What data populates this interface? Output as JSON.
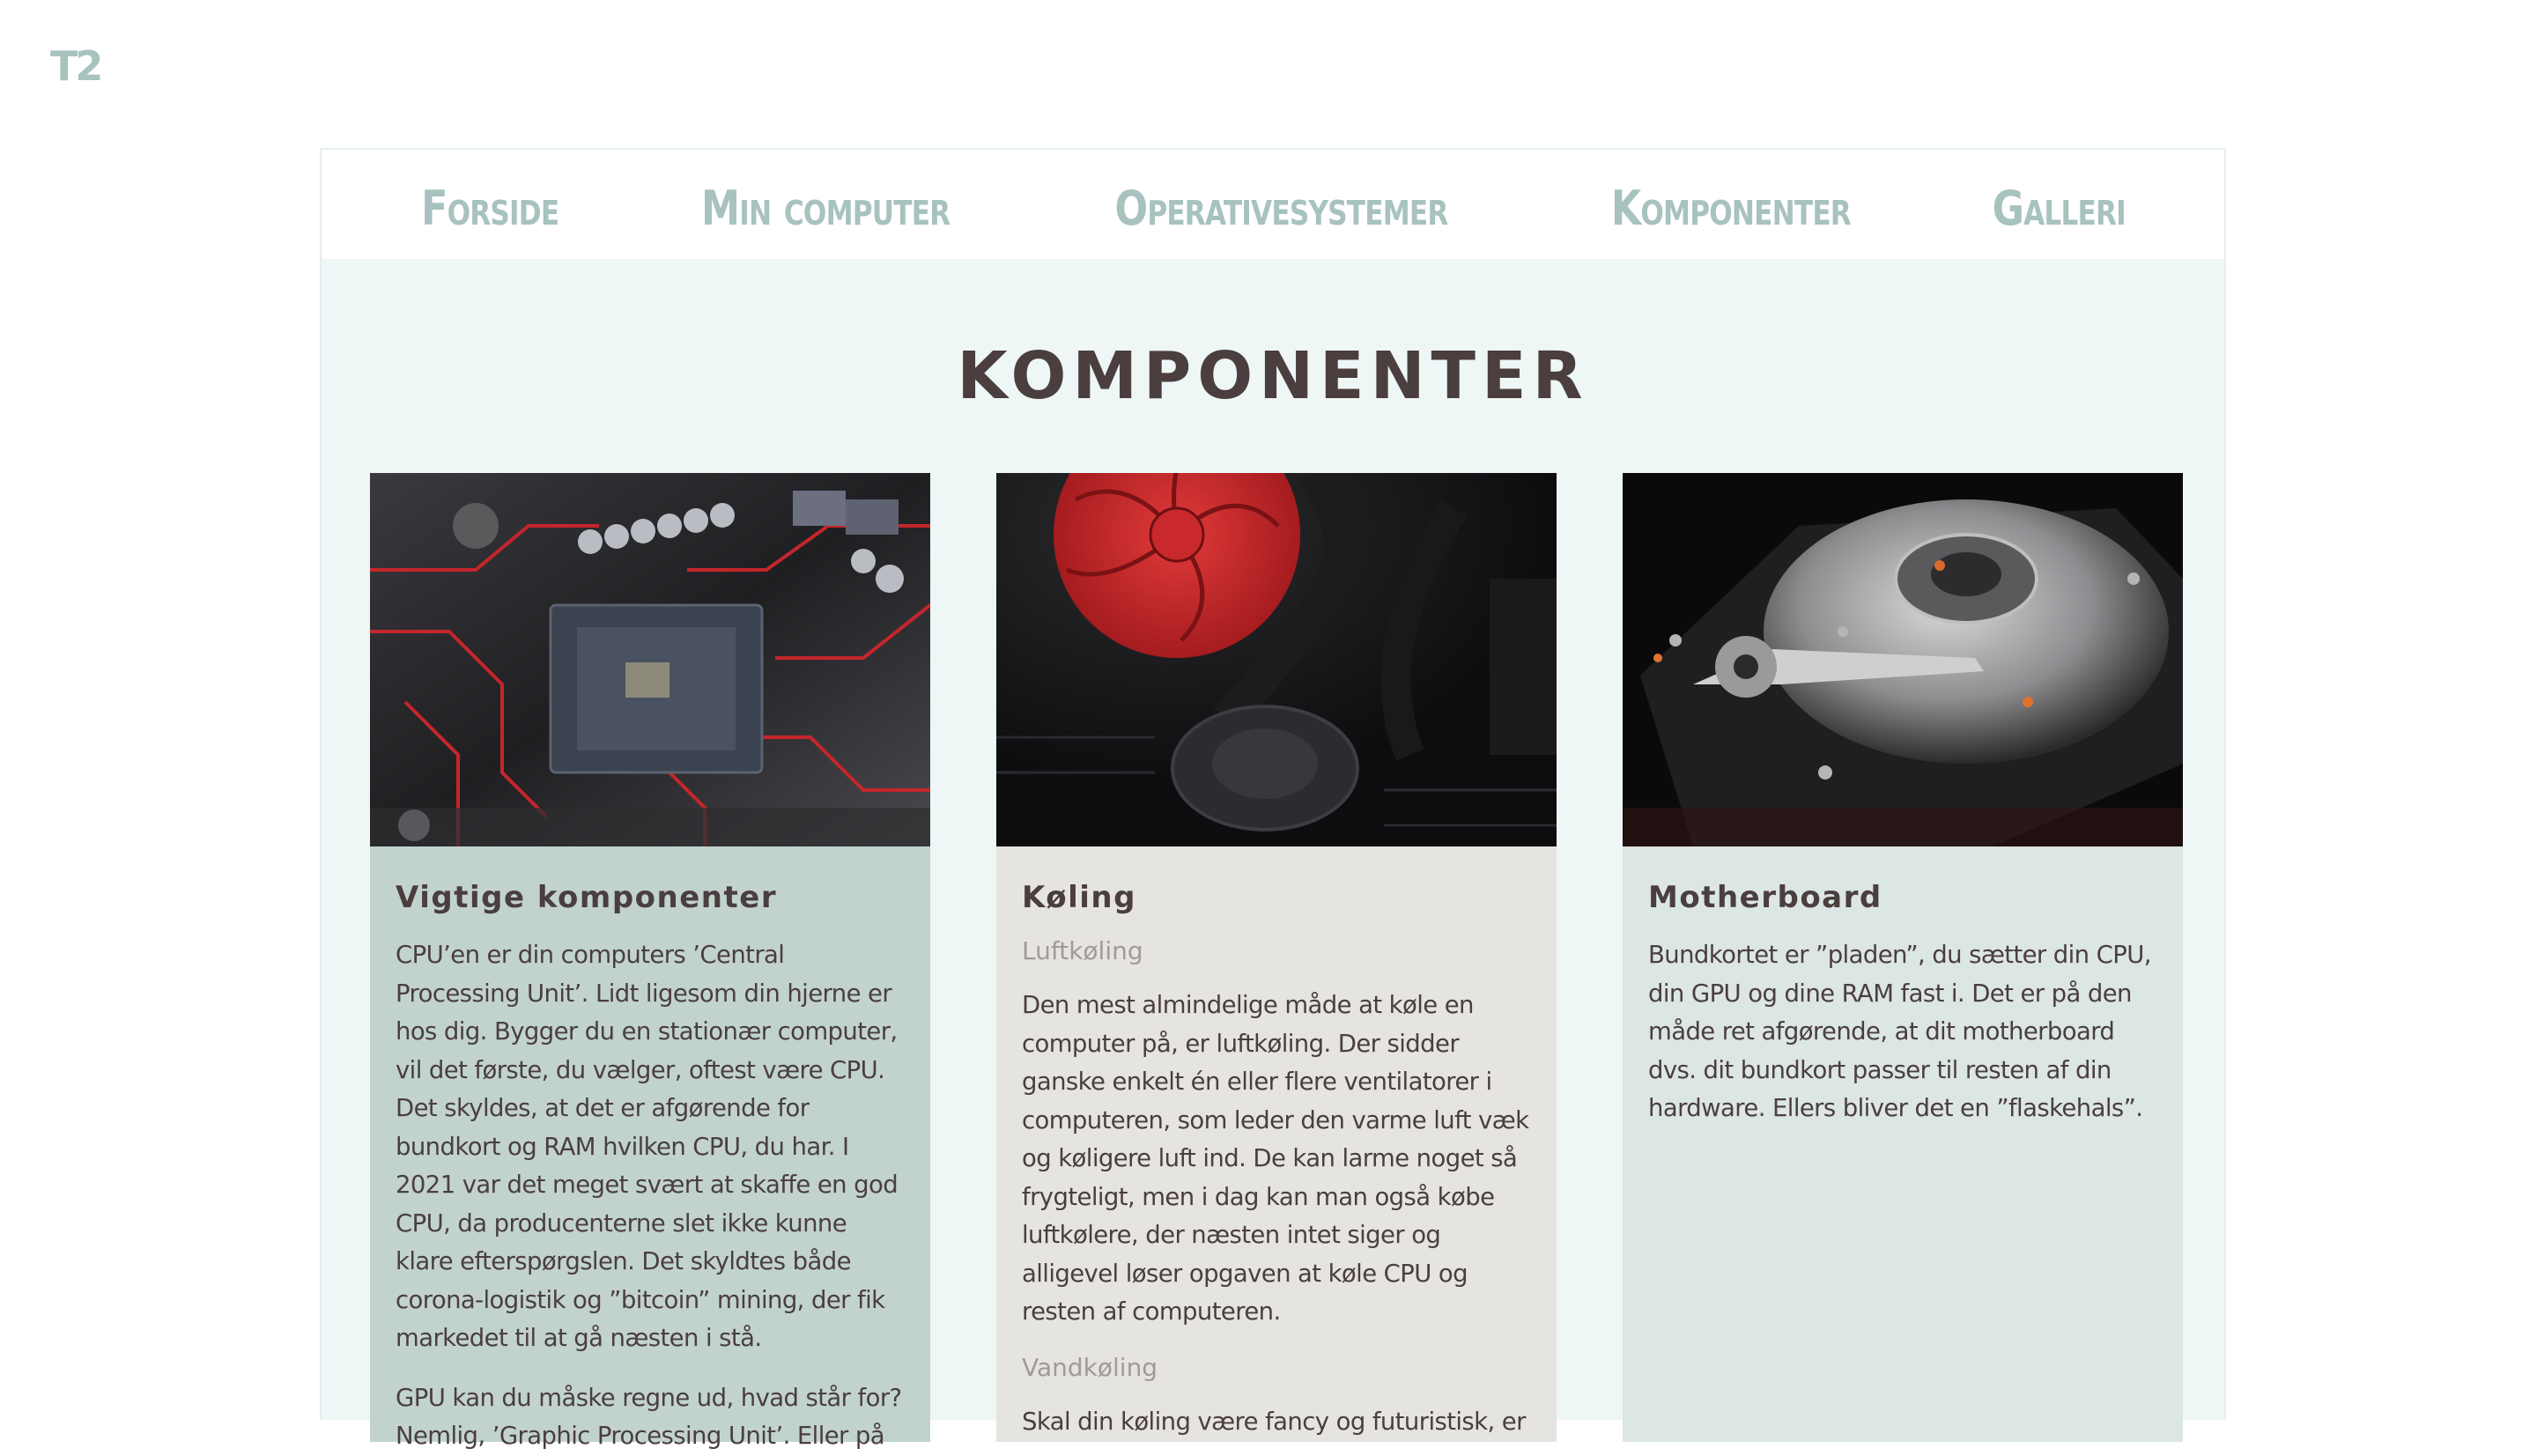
{
  "logo": "T2",
  "nav": {
    "items": [
      "Forside",
      "Min computer",
      "Operativesystemer",
      "Komponenter",
      "Galleri"
    ]
  },
  "page_title": "KOMPONENTER",
  "cards": [
    {
      "title": "Vigtige komponenter",
      "image": "motherboard-cpu-socket-photo",
      "paragraphs": [
        "CPU’en er din computers ’Central Processing Unit’. Lidt ligesom din hjerne er hos dig. Bygger du en stationær computer, vil det første, du vælger, oftest være CPU. Det skyldes, at det er afgørende for bundkort og RAM hvilken CPU, du har. I 2021 var det meget svært at skaffe en god CPU, da producenterne slet ikke kunne klare efterspørgslen. Det skyldtes både corona-logistik og ”bitcoin” mining, der fik markedet til at gå næsten i stå.",
        "GPU kan du måske regne ud, hvad står for? Nemlig, ’Graphic Processing Unit’. Eller på"
      ]
    },
    {
      "title": "Køling",
      "image": "red-cpu-fan-photo",
      "sub1": "Luftkøling",
      "text1": "Den mest almindelige måde at køle en computer på, er luftkøling. Der sidder ganske enkelt én eller flere ventilatorer i computeren, som leder den varme luft væk og køligere luft ind. De kan larme noget så frygteligt, men i dag kan man også købe luftkølere, der næsten intet siger og alligevel løser opgaven at køle CPU og resten af computeren.",
      "sub2": "Vandkøling",
      "text2": "Skal din køling være fancy og futuristisk, er"
    },
    {
      "title": "Motherboard",
      "image": "hard-drive-photo",
      "paragraphs": [
        "Bundkortet er ”pladen”, du sætter din CPU, din GPU og dine RAM fast i. Det er på den måde ret afgørende, at dit motherboard dvs. dit bundkort passer til resten af din hardware. Ellers bliver det en ”flaskehals”."
      ]
    }
  ]
}
